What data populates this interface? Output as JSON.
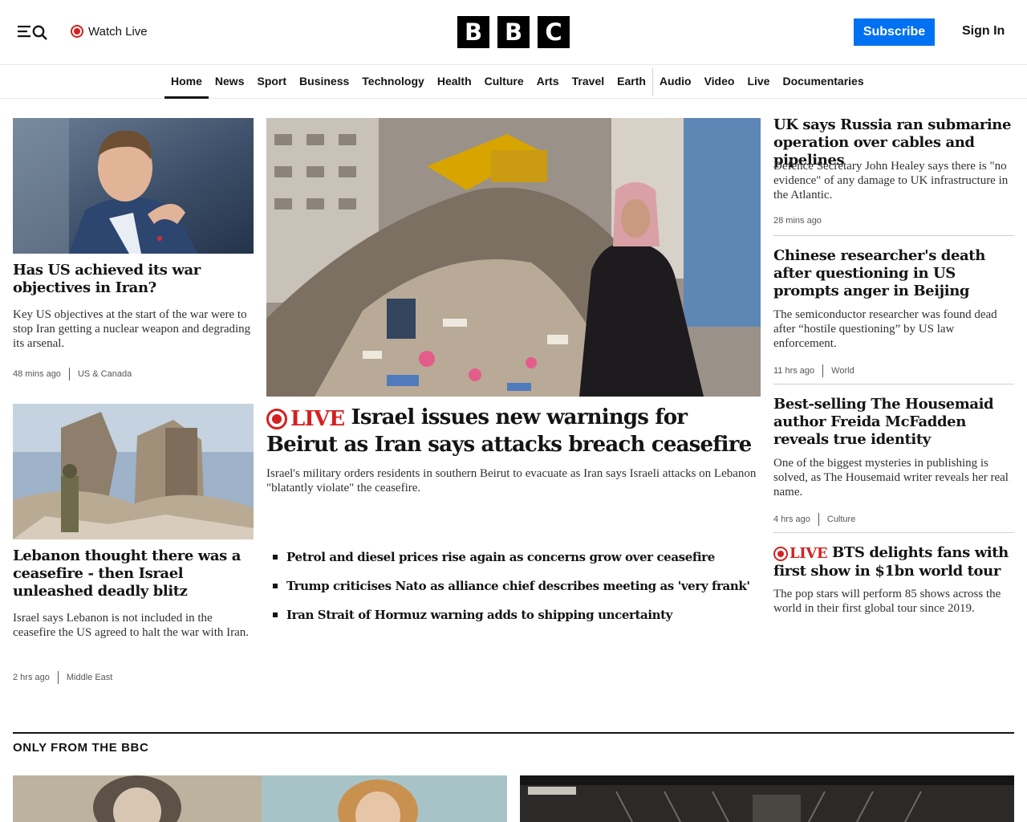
{
  "header": {
    "watch_live": "Watch Live",
    "logo_letters": [
      "B",
      "B",
      "C"
    ],
    "subscribe": "Subscribe",
    "sign_in": "Sign In",
    "icons": {
      "menu": "menu-icon",
      "search": "search-icon",
      "live": "live-dot-icon"
    }
  },
  "nav": {
    "items": [
      "Home",
      "News",
      "Sport",
      "Business",
      "Technology",
      "Health",
      "Culture",
      "Arts",
      "Travel",
      "Earth",
      "Audio",
      "Video",
      "Live",
      "Documentaries"
    ],
    "active": "Home"
  },
  "left": {
    "story1": {
      "title": "Has US achieved its war objectives in Iran?",
      "summary": "Key US objectives at the start of the war were to stop Iran getting a nuclear weapon and degrading its arsenal.",
      "time": "48 mins ago",
      "category": "US & Canada"
    },
    "story2": {
      "title": "Lebanon thought there was a ceasefire - then Israel unleashed deadly blitz",
      "summary": "Israel says Lebanon is not included in the ceasefire the US agreed to halt the war with Iran.",
      "time": "2 hrs ago",
      "category": "Middle East"
    }
  },
  "hero": {
    "live_label": "LIVE",
    "title": "Israel issues new warnings for Beirut as Iran says attacks breach ceasefire",
    "summary": "Israel's military orders residents in southern Beirut to evacuate as Iran says Israeli attacks on Lebanon \"blatantly violate\" the ceasefire.",
    "related": [
      "Petrol and diesel prices rise again as concerns grow over ceasefire",
      "Trump criticises Nato as alliance chief describes meeting as 'very frank'",
      "Iran Strait of Hormuz warning adds to shipping uncertainty"
    ]
  },
  "right": {
    "story1": {
      "title": "UK says Russia ran submarine operation over cables and pipelines",
      "summary": "Defence Secretary John Healey says there is \"no evidence\" of any damage to UK infrastructure in the Atlantic.",
      "time": "28 mins ago"
    },
    "story2": {
      "title": "Chinese researcher's death after questioning in US prompts anger in Beijing",
      "summary": "The semiconductor researcher was found dead after “hostile questioning” by US law enforcement.",
      "time": "11 hrs ago",
      "category": "World"
    },
    "story3": {
      "title": "Best-selling The Housemaid author Freida McFadden reveals true identity",
      "summary": "One of the biggest mysteries in publishing is solved, as The Housemaid writer reveals her real name.",
      "time": "4 hrs ago",
      "category": "Culture"
    },
    "story4": {
      "live_label": "LIVE",
      "title": "BTS delights fans with first show in $1bn world tour",
      "summary": "The pop stars will perform 85 shows across the world in their first global tour since 2019."
    }
  },
  "section": {
    "title": "ONLY FROM THE BBC"
  },
  "colors": {
    "accent_blue": "#0071f1",
    "live_red": "#d42020",
    "text": "#141414"
  }
}
